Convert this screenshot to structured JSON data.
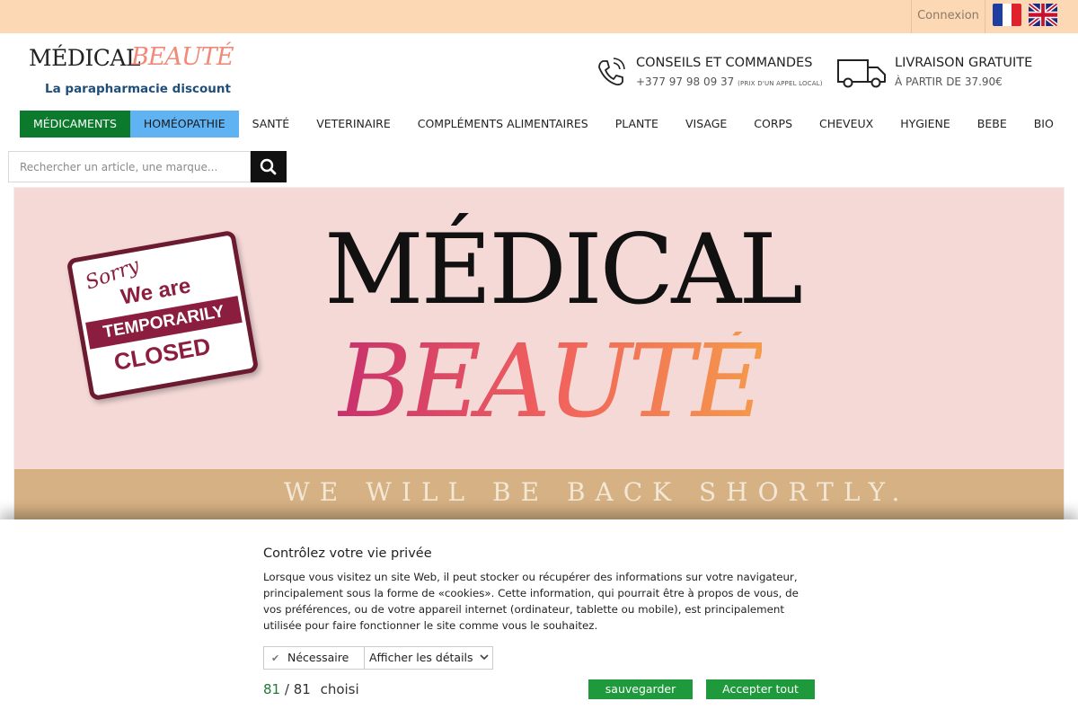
{
  "topbar": {
    "login_label": "Connexion",
    "languages": [
      {
        "code": "fr",
        "icon": "flag-france-icon"
      },
      {
        "code": "en",
        "icon": "flag-uk-icon"
      }
    ]
  },
  "header": {
    "logo_main": "MÉDICAL",
    "logo_accent": "BEAUTÉ",
    "tagline": "La parapharmacie discount",
    "contact_title": "CONSEILS ET COMMANDES",
    "contact_phone": "+377 97 98 09 37",
    "contact_note": "(PRIX D'UN APPEL LOCAL)",
    "shipping_title": "LIVRAISON GRATUITE",
    "shipping_sub": "À PARTIR DE 37.90€"
  },
  "nav": {
    "items": [
      "MÉDICAMENTS",
      "HOMÉOPATHIE",
      "SANTÉ",
      "VETERINAIRE",
      "COMPLÉMENTS ALIMENTAIRES",
      "PLANTE",
      "VISAGE",
      "CORPS",
      "CHEVEUX",
      "HYGIENE",
      "BEBE",
      "BIO"
    ]
  },
  "search": {
    "placeholder": "Rechercher un article, une marque..."
  },
  "banner": {
    "sign_line1": "Sorry",
    "sign_line2": "We are",
    "sign_line3": "TEMPORARILY",
    "sign_line4": "CLOSED",
    "title_main": "MÉDICAL",
    "title_accent": "BEAUTÉ",
    "tagline": "WE WILL BE BACK SHORTLY."
  },
  "cookie": {
    "title": "Contrôlez votre vie privée",
    "description": "Lorsque vous visitez un site Web, il peut stocker ou récupérer des informations sur votre navigateur, principalement sous la forme de «cookies». Cette information, qui pourrait être à propos de vous, de vos préférences, ou de votre appareil internet (ordinateur, tablette ou mobile), est principalement utilisée pour faire fonctionner le site comme vous le souhaitez.",
    "necessary_label": "Nécessaire",
    "details_label": "Afficher les détails",
    "chosen_count": "81",
    "total_count": "81",
    "chosen_label": "choisi",
    "save_label": "sauvegarder",
    "accept_label": "Accepter tout"
  },
  "colors": {
    "topbar": "#fcd9b4",
    "nav_active_green": "#0c7a2c",
    "nav_active_blue": "#5fb3f2",
    "button_green": "#1e9a3c",
    "tagline_blue": "#1f4e79"
  }
}
